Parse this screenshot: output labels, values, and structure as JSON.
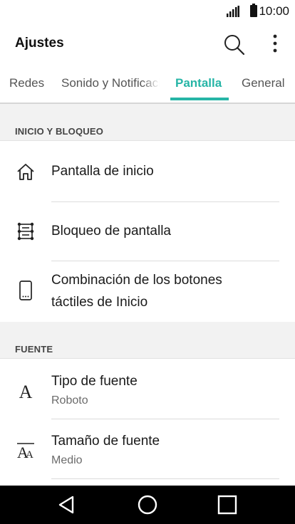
{
  "status_bar": {
    "time": "10:00",
    "signal_icon": "signal-icon",
    "battery_icon": "battery-icon"
  },
  "app_bar": {
    "title": "Ajustes",
    "search_icon": "search-icon",
    "more_icon": "more-vert-icon"
  },
  "tabs": [
    {
      "label": "Redes",
      "selected": false
    },
    {
      "label": "Sonido y Notificaciones",
      "selected": false
    },
    {
      "label": "Pantalla",
      "selected": true
    },
    {
      "label": "General",
      "selected": false
    }
  ],
  "accent_color": "#26b5a6",
  "sections": [
    {
      "header": "INICIO Y BLOQUEO",
      "items": [
        {
          "icon": "home-icon",
          "label": "Pantalla de inicio"
        },
        {
          "icon": "lock-screen-pattern-icon",
          "label": "Bloqueo de pantalla"
        },
        {
          "icon": "phone-touch-buttons-icon",
          "label_line1": "Combinación de los botones",
          "label_line2": "táctiles de Inicio"
        }
      ]
    },
    {
      "header": "FUENTE",
      "items": [
        {
          "icon": "font-type-icon",
          "label": "Tipo de fuente",
          "sub": "Roboto"
        },
        {
          "icon": "font-size-icon",
          "label": "Tamaño de fuente",
          "sub": "Medio"
        }
      ]
    }
  ],
  "nav_bar": {
    "back_icon": "back-triangle-icon",
    "home_icon": "home-circle-icon",
    "recents_icon": "recents-square-icon"
  }
}
